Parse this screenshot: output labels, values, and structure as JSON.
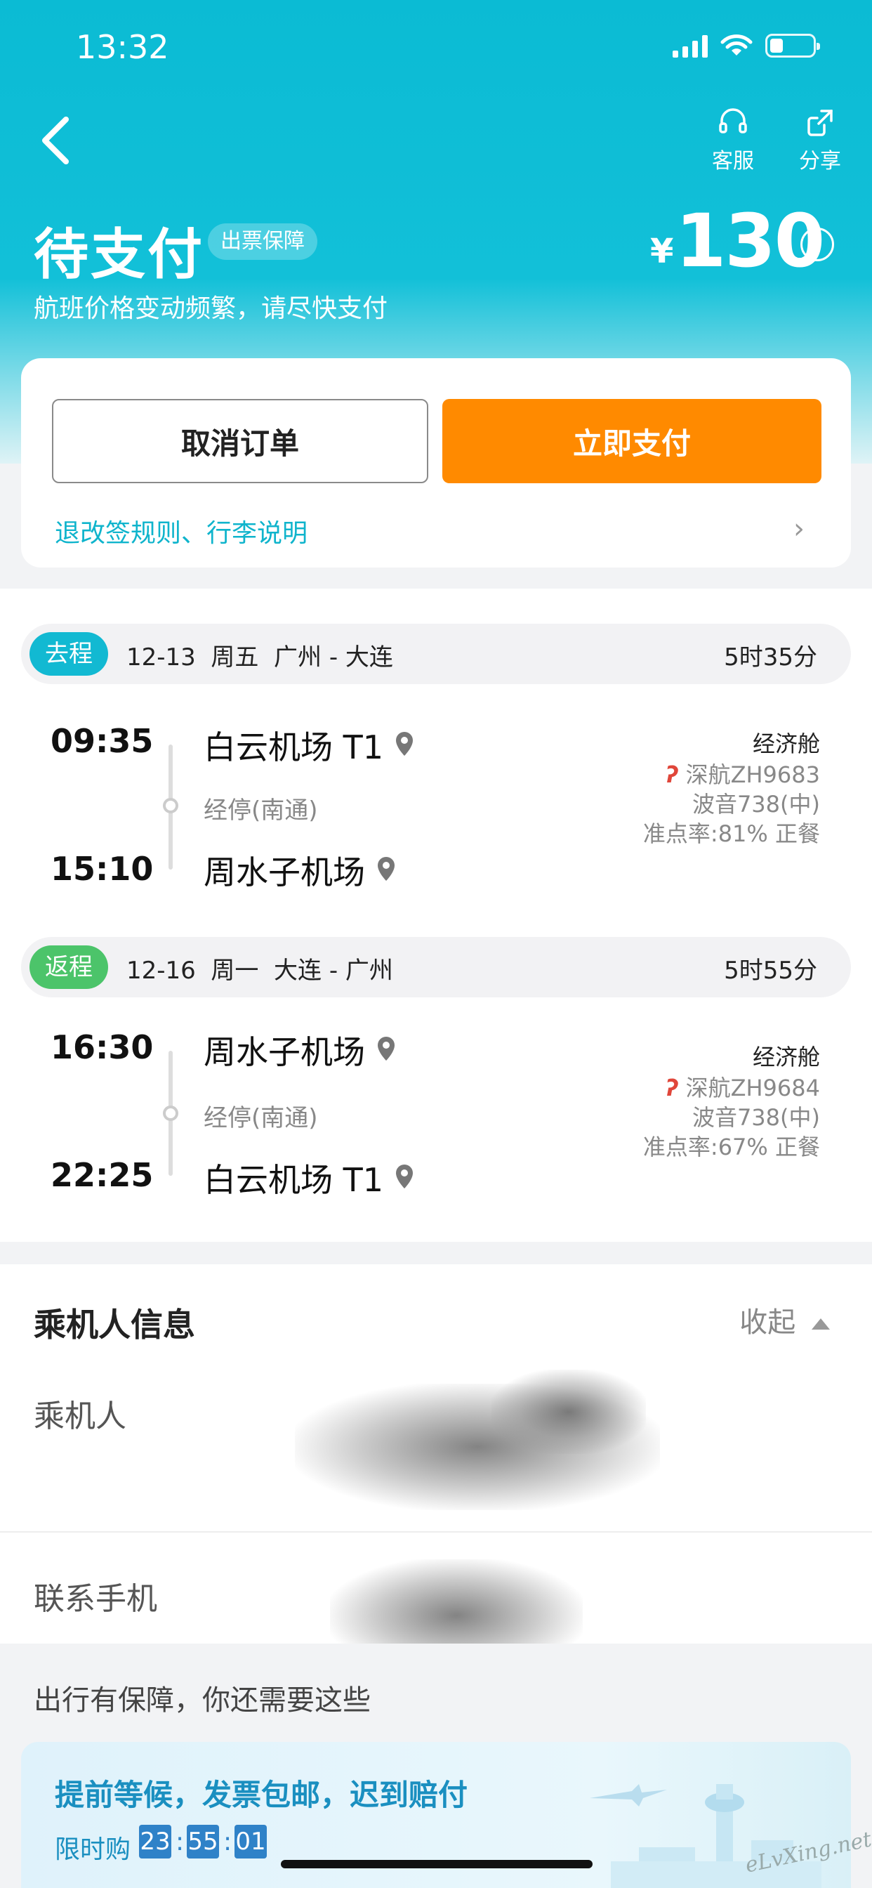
{
  "status_bar": {
    "time": "13:32"
  },
  "header": {
    "actions": {
      "service": "客服",
      "share": "分享"
    },
    "status_title": "待支付",
    "guarantee_badge": "出票保障",
    "subtitle": "航班价格变动频繁，请尽快支付",
    "currency": "¥",
    "price": "130",
    "info_icon": "i"
  },
  "actions": {
    "cancel_label": "取消订单",
    "pay_label": "立即支付",
    "rules_link": "退改签规则、行李说明",
    "chevron": "›"
  },
  "segments": [
    {
      "tag": "去程",
      "tag_color": "#12b9d2",
      "date": "12-13  周五  广州 - 大连",
      "duration": "5时35分",
      "dep_time": "09:35",
      "dep_airport": "白云机场 T1",
      "stop": "经停(南通)",
      "arr_time": "15:10",
      "arr_airport": "周水子机场",
      "cabin": "经济舱",
      "flight_no": "深航ZH9683",
      "aircraft": "波音738(中)",
      "punctuality": "准点率:81% 正餐"
    },
    {
      "tag": "返程",
      "tag_color": "#4cc46a",
      "date": "12-16  周一  大连 - 广州",
      "duration": "5时55分",
      "dep_time": "16:30",
      "dep_airport": "周水子机场",
      "stop": "经停(南通)",
      "arr_time": "22:25",
      "arr_airport": "白云机场 T1",
      "cabin": "经济舱",
      "flight_no": "深航ZH9684",
      "aircraft": "波音738(中)",
      "punctuality": "准点率:67% 正餐"
    }
  ],
  "passenger": {
    "title": "乘机人信息",
    "collapse_label": "收起",
    "passenger_label": "乘机人",
    "contact_label": "联系手机"
  },
  "extras": {
    "title": "出行有保障，你还需要这些",
    "promo_text": "提前等候，发票包邮，迟到赔付",
    "limit_label": "限时购",
    "countdown": {
      "h": "23",
      "m": "55",
      "s": "01"
    }
  },
  "watermark": "eLvXing.net",
  "colors": {
    "brand": "#12c0d8",
    "pay": "#ff8a00",
    "link": "#0fb4cc"
  }
}
